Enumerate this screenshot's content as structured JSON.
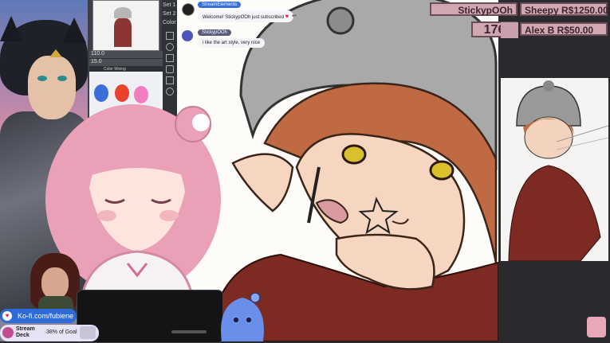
{
  "app": {
    "layer_set_1": "Set 1",
    "layer_set_2": "Set 2",
    "color_tab": "Color",
    "color_mixing_label": "Color Mixing",
    "brush_size": "110.0",
    "brush_opacity": "15.0",
    "swatch_colors": [
      "#3b6fd8",
      "#e8422c",
      "#f27cc0"
    ]
  },
  "chat": {
    "messages": [
      {
        "user": "StreamElements",
        "text": "Welcome! StickypOOh just subscribed",
        "emoji": "heart-icon",
        "name_color": "#3a6fd8"
      },
      {
        "user": "StickypOOh",
        "text": "i like the art style, very nice",
        "name_color": "#5a5a7c"
      }
    ]
  },
  "goals": {
    "latest_sub": "StickypOOh",
    "sub_count": "176",
    "donation_1": "Sheepy R$1250.00",
    "donation_2": "Alex B R$50.00"
  },
  "socials": {
    "kofi": "Ko-fi.com/fubiene",
    "streamdeck_label": "Stream Deck",
    "goal_progress": "38% of Goal",
    "goal_fraction": 0.38
  },
  "colors": {
    "goal_badge_bg": "#d1a7b2",
    "goal_badge_border": "#6c4c57",
    "kofi_blue": "#2e6bd6"
  }
}
